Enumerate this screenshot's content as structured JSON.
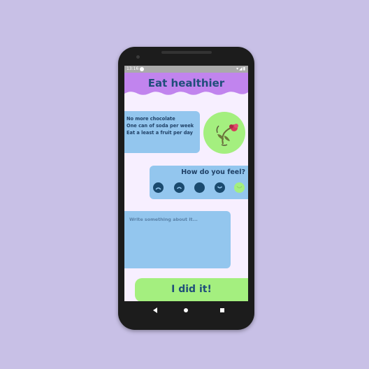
{
  "status": {
    "time": "13:16",
    "icons": "▾◢▮"
  },
  "header": {
    "title": "Eat healthier"
  },
  "goals": [
    "No more chocolate",
    "One can of soda per week",
    "Eat a least a fruit per day"
  ],
  "feel": {
    "title": "How do you feel?"
  },
  "moods": [
    {
      "name": "very-sad",
      "selected": false
    },
    {
      "name": "sad",
      "selected": false
    },
    {
      "name": "neutral",
      "selected": false
    },
    {
      "name": "happy",
      "selected": false
    },
    {
      "name": "very-happy",
      "selected": true
    }
  ],
  "note": {
    "placeholder": "Write something about it..."
  },
  "action": {
    "did_it_label": "I did it!"
  },
  "colors": {
    "background": "#c8c0e6",
    "header": "#c184ee",
    "card": "#93c6ee",
    "accent_green": "#a4ef7f",
    "text_dark": "#1f4e7a"
  }
}
